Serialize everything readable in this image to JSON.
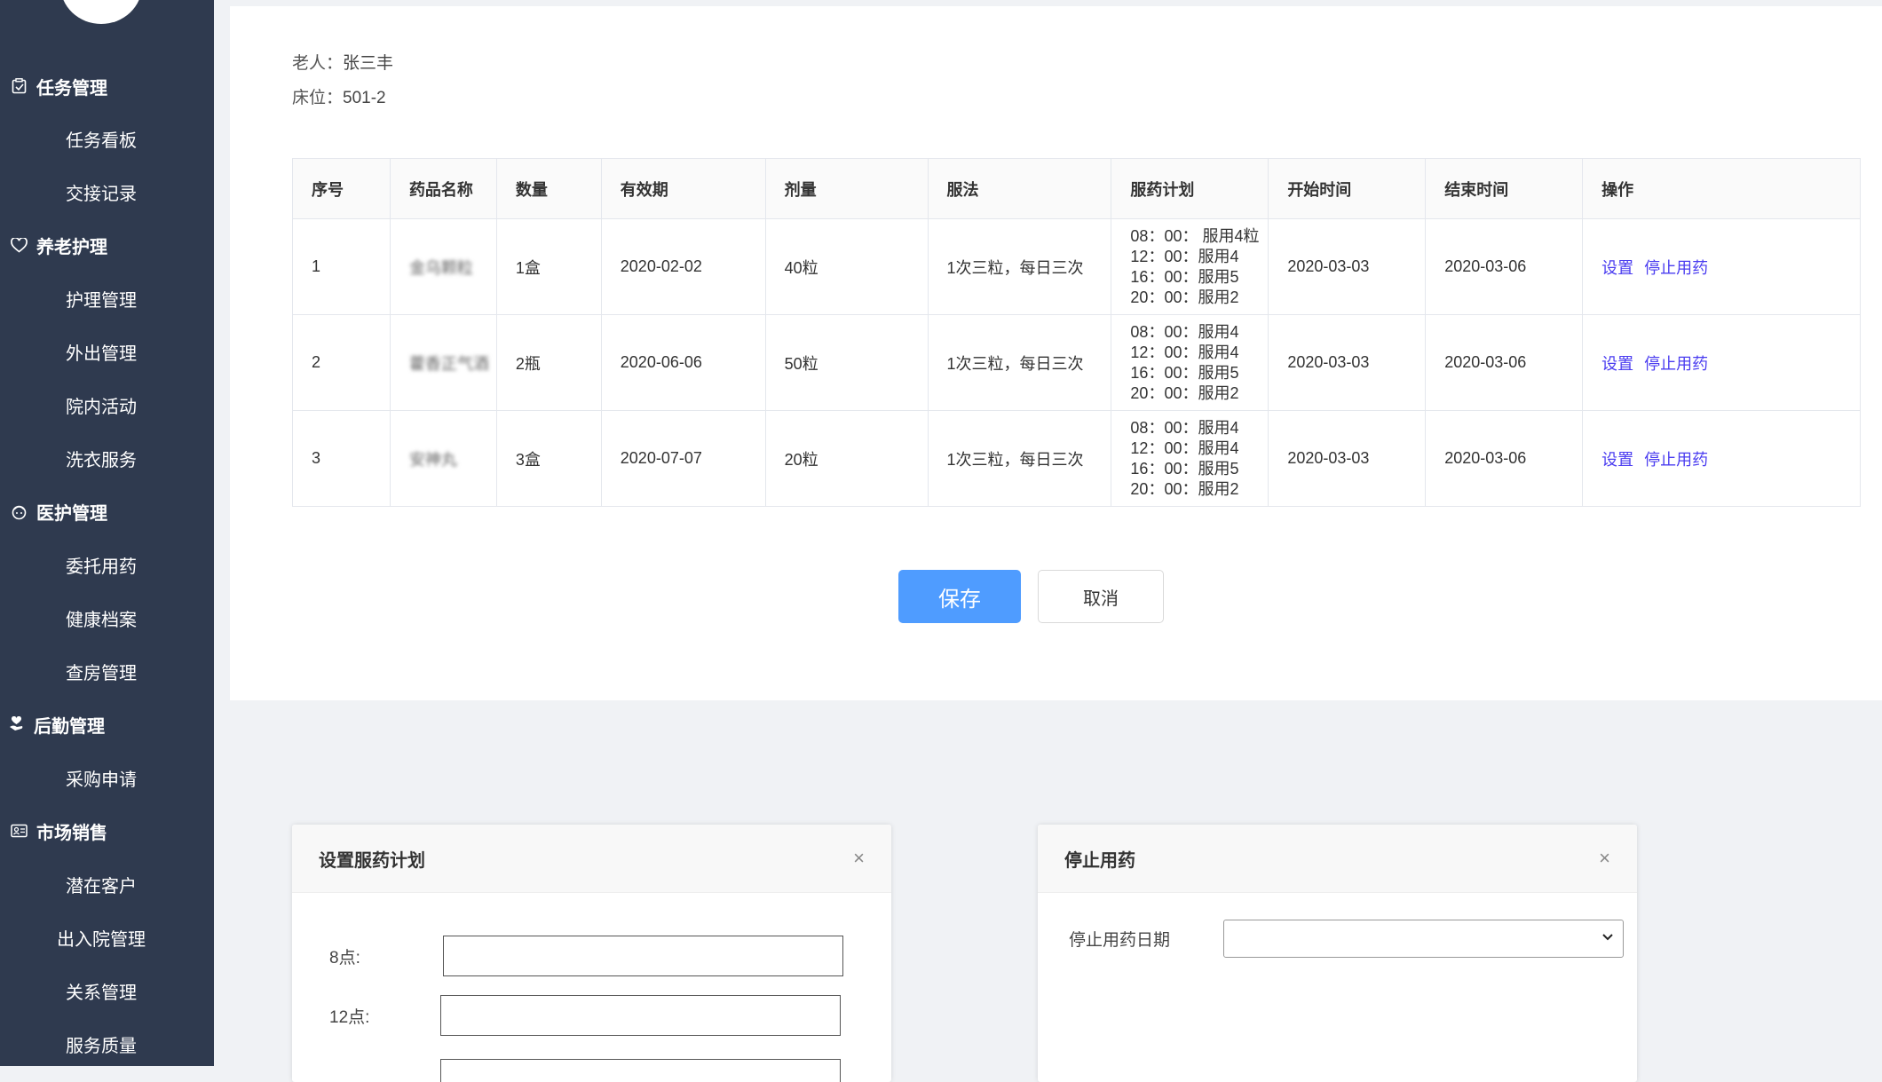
{
  "sidebar": {
    "groups": [
      {
        "label": "任务管理",
        "icon": "clipboard-check-icon",
        "items": [
          "任务看板",
          "交接记录"
        ]
      },
      {
        "label": "养老护理",
        "icon": "heart-icon",
        "items": [
          "护理管理",
          "外出管理",
          "院内活动",
          "洗衣服务"
        ]
      },
      {
        "label": "医护管理",
        "icon": "nurse-icon",
        "items": [
          "委托用药",
          "健康档案",
          "查房管理"
        ]
      },
      {
        "label": "后勤管理",
        "icon": "hand-heart-icon",
        "items": [
          "采购申请"
        ]
      },
      {
        "label": "市场销售",
        "icon": "id-card-icon",
        "items": [
          "潜在客户",
          "出入院管理",
          "关系管理",
          "服务质量"
        ]
      }
    ]
  },
  "info": {
    "elder_label": "老人：",
    "elder_name": "张三丰",
    "bed_label": "床位：",
    "bed_value": "501-2"
  },
  "table": {
    "headers": [
      "序号",
      "药品名称",
      "数量",
      "有效期",
      "剂量",
      "服法",
      "服药计划",
      "开始时间",
      "结束时间",
      "操作"
    ],
    "rows": [
      {
        "no": "1",
        "name": "金乌颗粒",
        "qty": "1盒",
        "expiry": "2020-02-02",
        "dose": "40粒",
        "usage": "1次三粒，每日三次",
        "plan": [
          "08：00： 服用4粒",
          "12：00：服用4",
          "16：00：服用5",
          "20：00：服用2"
        ],
        "start": "2020-03-03",
        "end": "2020-03-06",
        "action_set": "设置",
        "action_stop": "停止用药"
      },
      {
        "no": "2",
        "name": "藿香正气酒",
        "qty": "2瓶",
        "expiry": "2020-06-06",
        "dose": "50粒",
        "usage": "1次三粒，每日三次",
        "plan": [
          "08：00：服用4",
          "12：00：服用4",
          "16：00：服用5",
          "20：00：服用2"
        ],
        "start": "2020-03-03",
        "end": "2020-03-06",
        "action_set": "设置",
        "action_stop": "停止用药"
      },
      {
        "no": "3",
        "name": "安神丸",
        "qty": "3盒",
        "expiry": "2020-07-07",
        "dose": "20粒",
        "usage": "1次三粒，每日三次",
        "plan": [
          "08：00：服用4",
          "12：00：服用4",
          "16：00：服用5",
          "20：00：服用2"
        ],
        "start": "2020-03-03",
        "end": "2020-03-06",
        "action_set": "设置",
        "action_stop": "停止用药"
      }
    ]
  },
  "buttons": {
    "save": "保存",
    "cancel": "取消"
  },
  "dialog_plan": {
    "title": "设置服药计划",
    "close": "×",
    "label_8": "8点:",
    "label_12": "12点:",
    "value_8": "",
    "value_12": ""
  },
  "dialog_stop": {
    "title": "停止用药",
    "close": "×",
    "date_label": "停止用药日期",
    "date_value": ""
  },
  "colors": {
    "sidebar_bg": "#2f3a4f",
    "primary": "#4f9cff",
    "link": "#4a3cf0"
  }
}
